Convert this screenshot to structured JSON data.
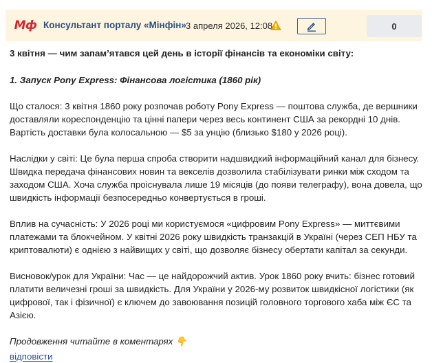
{
  "header": {
    "avatar_text": "Мф",
    "author": "Консультант порталу «Мінфін»",
    "date": "3 апреля 2026, 12:08",
    "warning_icon": "warning-icon",
    "edit_icon": "pencil-icon",
    "counter": "0",
    "colors": {
      "background": "#fdf5e0",
      "avatar": "#d4232b",
      "author": "#2b4f86",
      "link": "#2a5298"
    }
  },
  "content": {
    "intro": "3 квітня — чим запам’ятався цей день в історії фінансів та економіки світу:",
    "section_title": "1. Запуск Pony Express: Фінансова логістика (1860 рік)",
    "paragraphs": [
      "Що сталося: 3 квітня 1860 року розпочав роботу Pony Express — поштова служба, де вершники доставляли кореспонденцію та цінні папери через весь континент США за рекордні 10 днів. Вартість доставки була колосальною — $5 за унцію (близько $180 у 2026 році).",
      "Наслідки у світі: Це була перша спроба створити надшвидкий інформаційний канал для бізнесу. Швидка передача фінансових новин та векселів дозволила стабілізувати ринки між сходом та заходом США. Хоча служба проіснувала лише 19 місяців (до появи телеграфу), вона довела, що швидкість інформації безпосередньо конвертується в гроші.",
      "Вплив на сучасність: У 2026 році ми користуємося «цифровим Pony Express» — миттєвими платежами та блокчейном. У квітні 2026 року швидкість транзакцій в Україні (через СЕП НБУ та криптовалюти) є однією з найвищих у світі, що дозволяє бізнесу обертати капітал за секунди.",
      "Висновок/урок для України: Час — це найдорожчий актив. Урок 1860 року вчить: бізнес готовий платити величезні гроші за швидкість. Для України у 2026-му розвиток швидкісної логістики (як цифрової, так і фізичної) є ключем до завоювання позицій головного торгового хаба між ЄС та Азією."
    ],
    "continue_text": "Продовження читайте в коментарях 👇",
    "reply_link": "відповісти"
  }
}
